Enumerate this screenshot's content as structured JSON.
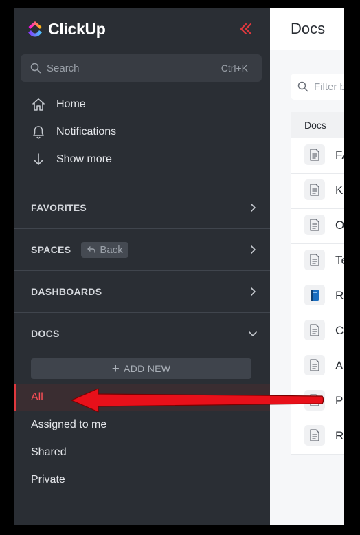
{
  "app": {
    "name": "ClickUp"
  },
  "search": {
    "placeholder": "Search",
    "shortcut": "Ctrl+K"
  },
  "nav": [
    {
      "label": "Home",
      "icon": "home-icon"
    },
    {
      "label": "Notifications",
      "icon": "bell-icon"
    },
    {
      "label": "Show more",
      "icon": "arrow-down-icon"
    }
  ],
  "sections": {
    "favorites": "FAVORITES",
    "spaces": "SPACES",
    "back": "Back",
    "dashboards": "DASHBOARDS",
    "docs": "DOCS"
  },
  "docs_sidebar": {
    "add_new": "ADD NEW",
    "links": [
      "All",
      "Assigned to me",
      "Shared",
      "Private"
    ],
    "active": "All"
  },
  "main": {
    "title": "Docs",
    "filter_placeholder": "Filter b",
    "column_header": "Docs",
    "rows": [
      {
        "initial": "FA",
        "icon": "doc-icon"
      },
      {
        "initial": "K",
        "icon": "doc-icon"
      },
      {
        "initial": "O",
        "icon": "doc-icon"
      },
      {
        "initial": "Te",
        "icon": "doc-icon"
      },
      {
        "initial": "R",
        "icon": "book-icon"
      },
      {
        "initial": "C",
        "icon": "doc-icon"
      },
      {
        "initial": "A",
        "icon": "doc-icon"
      },
      {
        "initial": "P",
        "icon": "doc-icon"
      },
      {
        "initial": "R",
        "icon": "doc-icon"
      }
    ]
  },
  "colors": {
    "sidebar_bg": "#2a2e34",
    "accent_red": "#e0383e",
    "annotation_arrow": "#e8101a"
  }
}
